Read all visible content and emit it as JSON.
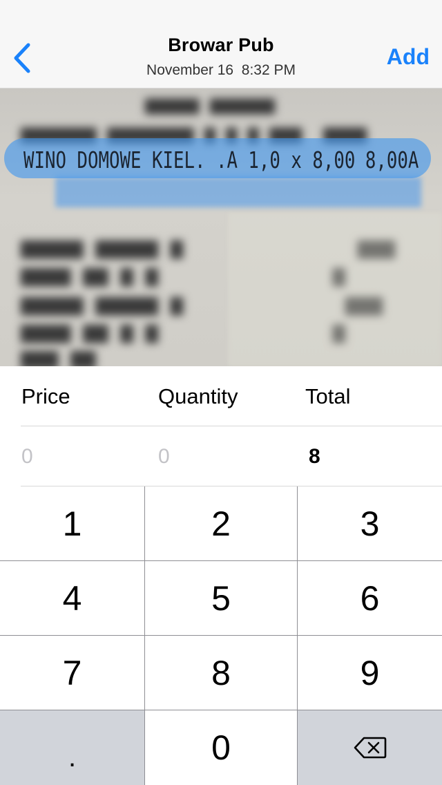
{
  "navbar": {
    "back_icon": "chevron-left-icon",
    "title": "Browar Pub",
    "subtitle": "November 16  8:32 PM",
    "add_label": "Add",
    "accent_color": "#1a82fb"
  },
  "receipt": {
    "highlighted_line": "WINO DOMOWE KIEL. .A 1,0 x 8,00",
    "highlighted_amount": "8,00A",
    "highlight_color": "#4096ee"
  },
  "entry": {
    "columns": [
      {
        "label": "Price",
        "value": "0",
        "is_placeholder": true
      },
      {
        "label": "Quantity",
        "value": "0",
        "is_placeholder": true
      },
      {
        "label": "Total",
        "value": "8",
        "is_placeholder": false
      }
    ]
  },
  "keypad": {
    "keys": [
      "1",
      "2",
      "3",
      "4",
      "5",
      "6",
      "7",
      "8",
      "9",
      ".",
      "0",
      "delete"
    ],
    "delete_icon": "backspace-icon"
  }
}
